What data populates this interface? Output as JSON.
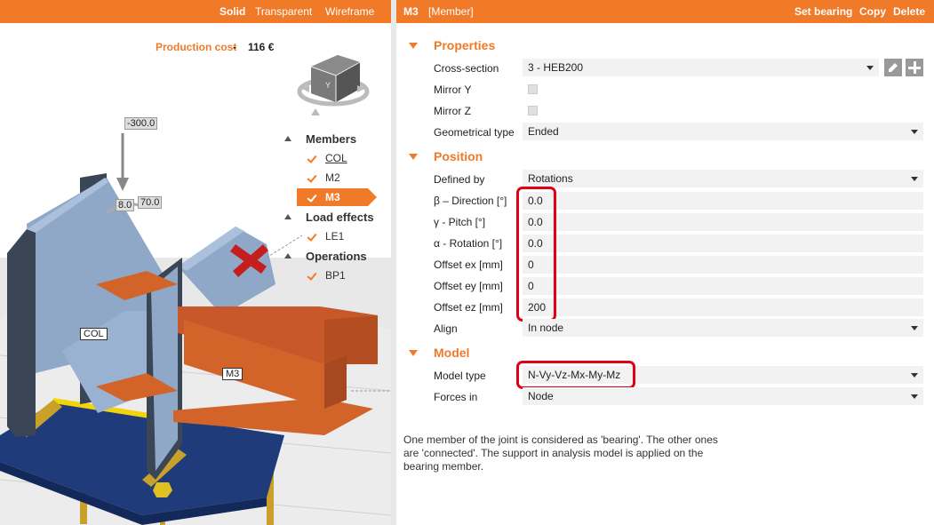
{
  "view_modes": [
    "Solid",
    "Transparent",
    "Wireframe"
  ],
  "production_cost": {
    "label": "Production cost",
    "separator": "-",
    "value": "116 €"
  },
  "tree": {
    "groups": [
      {
        "label": "Members",
        "items": [
          {
            "label": "COL",
            "selected": false,
            "underlined": true
          },
          {
            "label": "M2",
            "selected": false,
            "underlined": false
          },
          {
            "label": "M3",
            "selected": true,
            "underlined": false
          }
        ]
      },
      {
        "label": "Load effects",
        "items": [
          {
            "label": "LE1",
            "selected": false,
            "underlined": false
          }
        ]
      },
      {
        "label": "Operations",
        "items": [
          {
            "label": "BP1",
            "selected": false,
            "underlined": false
          }
        ]
      }
    ]
  },
  "viewport": {
    "dim_force": "-300.0",
    "dim_left": "8.0",
    "dim_right": "70.0",
    "tag_col": "COL",
    "tag_m3": "M3",
    "cube_face": "Y"
  },
  "header": {
    "title": "M3",
    "subtitle": "[Member]",
    "actions": [
      "Set bearing",
      "Copy",
      "Delete"
    ]
  },
  "sections": {
    "properties": "Properties",
    "position": "Position",
    "model": "Model"
  },
  "properties": {
    "cross_section_label": "Cross-section",
    "cross_section_value": "3 - HEB200",
    "mirror_y_label": "Mirror Y",
    "mirror_z_label": "Mirror Z",
    "geom_type_label": "Geometrical type",
    "geom_type_value": "Ended"
  },
  "position": {
    "defined_by_label": "Defined by",
    "defined_by_value": "Rotations",
    "beta_label": "β – Direction [°]",
    "beta_value": "0.0",
    "gamma_label": "γ - Pitch [°]",
    "gamma_value": "0.0",
    "alpha_label": "α - Rotation [°]",
    "alpha_value": "0.0",
    "ex_label": "Offset ex [mm]",
    "ex_value": "0",
    "ey_label": "Offset ey [mm]",
    "ey_value": "0",
    "ez_label": "Offset ez [mm]",
    "ez_value": "200",
    "align_label": "Align",
    "align_value": "In node"
  },
  "model": {
    "model_type_label": "Model type",
    "model_type_value": "N-Vy-Vz-Mx-My-Mz",
    "forces_in_label": "Forces in",
    "forces_in_value": "Node"
  },
  "description": "One member of the joint is considered as 'bearing'. The other ones are 'connected'. The support in analysis model is applied on the bearing member.",
  "colors": {
    "accent": "#f07a28",
    "highlight": "#e00012",
    "steel_blue": "#8fa8c8",
    "member_orange": "#d2642a",
    "base_plate": "#1f3b7a"
  }
}
